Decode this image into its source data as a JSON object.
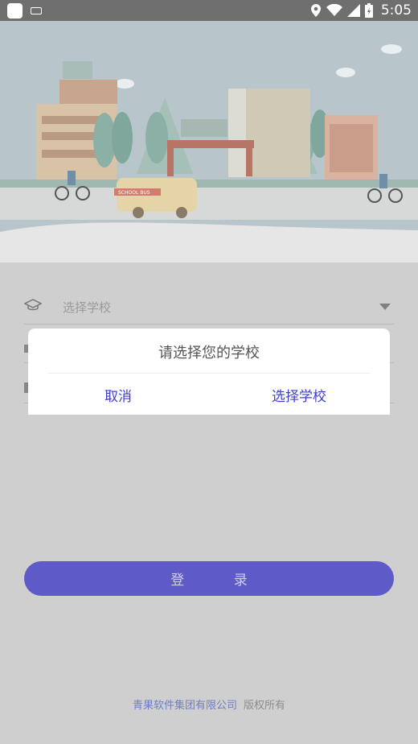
{
  "status_bar": {
    "time": "5:05"
  },
  "form": {
    "school_placeholder": "选择学校"
  },
  "login_button": {
    "label": "登 录"
  },
  "footer": {
    "company": "青果软件集团有限公司",
    "rights": "版权所有"
  },
  "dialog": {
    "title": "请选择您的学校",
    "cancel_label": "取消",
    "choose_label": "选择学校"
  },
  "colors": {
    "accent": "#5e5ac8",
    "dialog_button": "#3f3fcf",
    "overlay": "#cfcfcf"
  }
}
